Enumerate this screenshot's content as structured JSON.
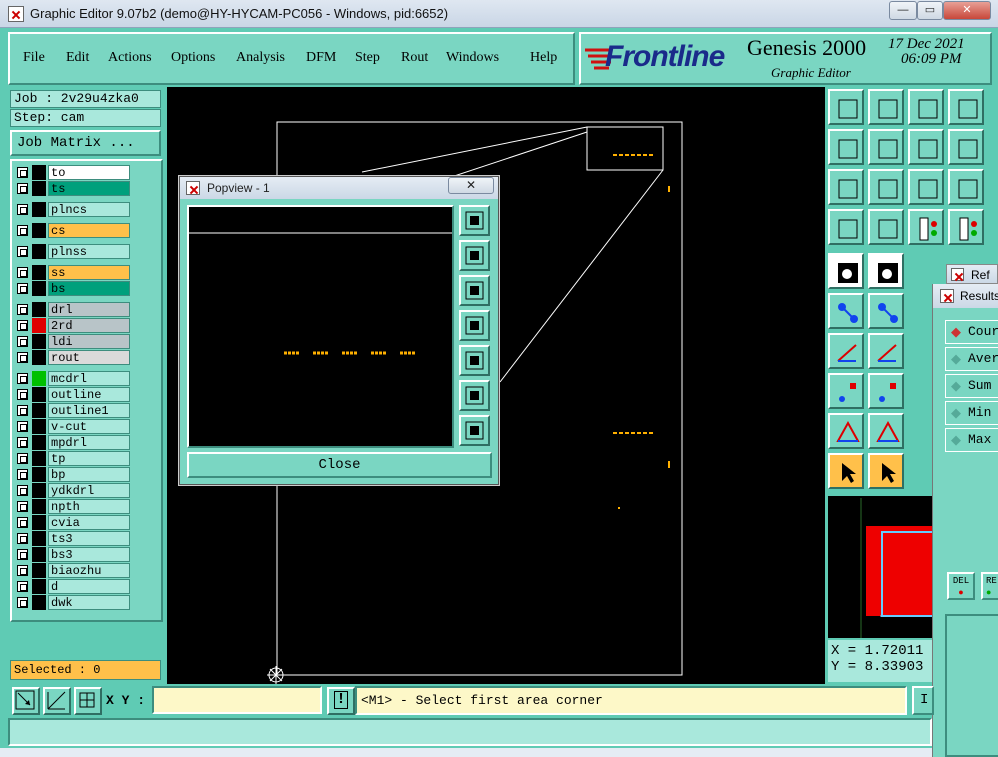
{
  "window": {
    "title": "Graphic Editor 9.07b2 (demo@HY-HYCAM-PC056 - Windows, pid:6652)",
    "minimize": "—",
    "maximize": "▭",
    "close": "✕"
  },
  "menu": [
    "File",
    "Edit",
    "Actions",
    "Options",
    "Analysis",
    "DFM",
    "Step",
    "Rout",
    "Windows",
    "Help"
  ],
  "logo": {
    "brand": "Frontline",
    "product": "Genesis 2000",
    "subtitle": "Graphic Editor",
    "date": "17 Dec 2021",
    "time": "06:09 PM"
  },
  "job": {
    "job_label": "Job : 2v29u4zka0",
    "step_label": "Step: cam",
    "matrix_button": "Job Matrix ..."
  },
  "layers": [
    {
      "name": "to",
      "bg": "#ffffff",
      "color": "#000000"
    },
    {
      "name": "ts",
      "bg": "#00a07c",
      "color": "#000000"
    },
    {
      "name": "plncs",
      "bg": "#a9e8dc",
      "color": "#000000"
    },
    {
      "name": "cs",
      "bg": "#ffc04a",
      "color": "#000000"
    },
    {
      "name": "plnss",
      "bg": "#a9e8dc",
      "color": "#000000"
    },
    {
      "name": "ss",
      "bg": "#ffc04a",
      "color": "#000000"
    },
    {
      "name": "bs",
      "bg": "#00a07c",
      "color": "#000000"
    },
    {
      "name": "drl",
      "bg": "#b8c4c8",
      "color": "#000000"
    },
    {
      "name": "2rd",
      "bg": "#b8c4c8",
      "color": "#e00000"
    },
    {
      "name": "ldi",
      "bg": "#b8c4c8",
      "color": "#000000"
    },
    {
      "name": "rout",
      "bg": "#dadada",
      "color": "#000000"
    },
    {
      "name": "mcdrl",
      "bg": "#a9e8dc",
      "color": "#00c000"
    },
    {
      "name": "outline",
      "bg": "#a9e8dc",
      "color": "#000000"
    },
    {
      "name": "outline1",
      "bg": "#a9e8dc",
      "color": "#000000"
    },
    {
      "name": "v-cut",
      "bg": "#a9e8dc",
      "color": "#000000"
    },
    {
      "name": "mpdrl",
      "bg": "#a9e8dc",
      "color": "#000000"
    },
    {
      "name": "tp",
      "bg": "#a9e8dc",
      "color": "#000000"
    },
    {
      "name": "bp",
      "bg": "#a9e8dc",
      "color": "#000000"
    },
    {
      "name": "ydkdrl",
      "bg": "#a9e8dc",
      "color": "#000000"
    },
    {
      "name": "npth",
      "bg": "#a9e8dc",
      "color": "#000000"
    },
    {
      "name": "cvia",
      "bg": "#a9e8dc",
      "color": "#000000"
    },
    {
      "name": "ts3",
      "bg": "#a9e8dc",
      "color": "#000000"
    },
    {
      "name": "bs3",
      "bg": "#a9e8dc",
      "color": "#000000"
    },
    {
      "name": "biaozhu",
      "bg": "#a9e8dc",
      "color": "#000000"
    },
    {
      "name": "d",
      "bg": "#a9e8dc",
      "color": "#000000"
    },
    {
      "name": "dwk",
      "bg": "#a9e8dc",
      "color": "#000000"
    }
  ],
  "selected": "Selected : 0",
  "popview": {
    "title": "Popview - 1",
    "close_label": "Close"
  },
  "coords": {
    "x": "X = 1.72011",
    "y": "Y = 8.33903"
  },
  "statusbar": {
    "xy_label": "X Y :",
    "xy_value": "",
    "bang": "!",
    "prompt": "<M1> - Select first area corner",
    "right_stub": "I"
  },
  "results": {
    "title": "Results",
    "ref_title": "Ref",
    "items": [
      "Cour",
      "Aver",
      "Sum",
      "Min",
      "Max"
    ],
    "del_label": "DEL",
    "re_label": "RE"
  }
}
